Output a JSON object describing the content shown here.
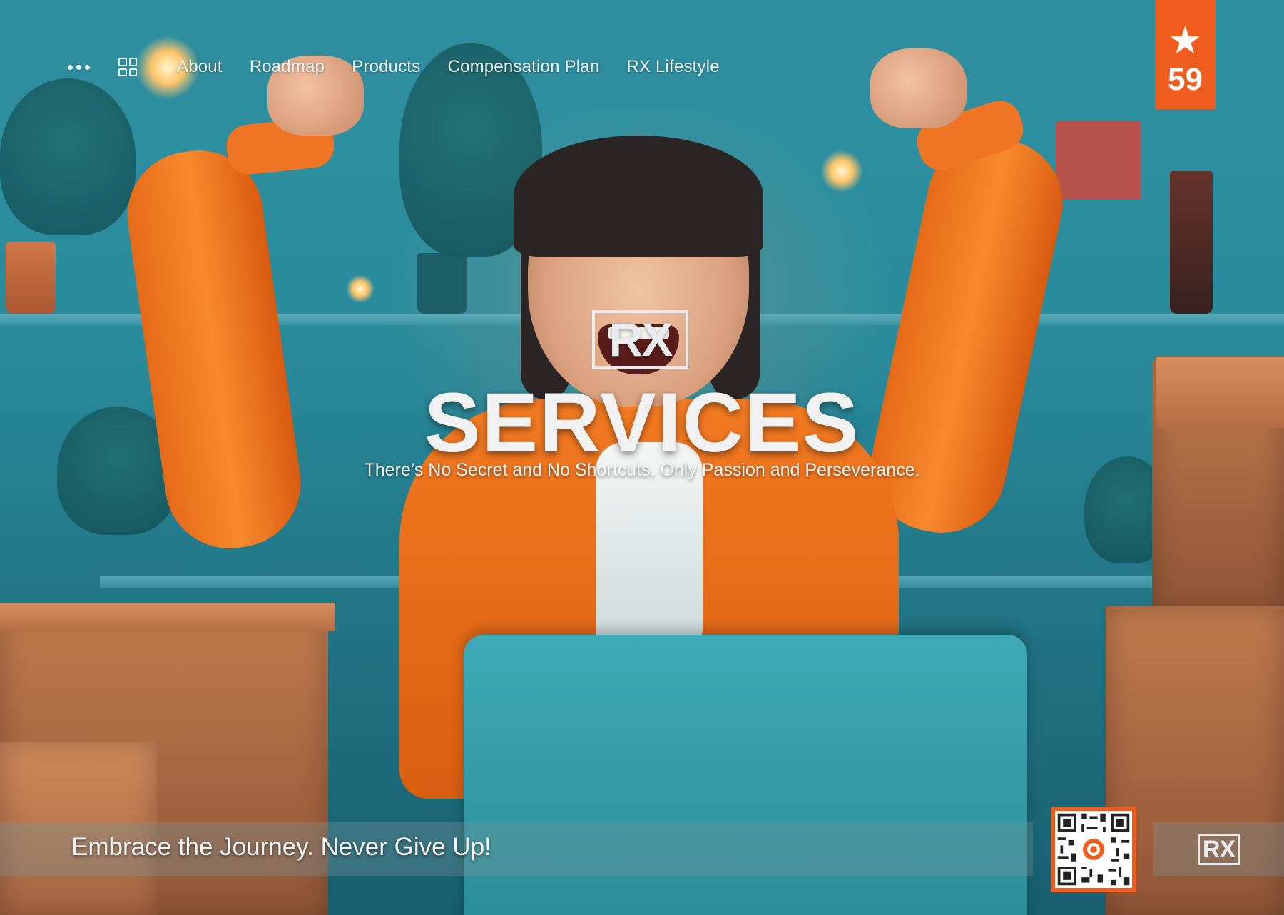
{
  "nav": {
    "items": [
      "About",
      "Roadmap",
      "Products",
      "Compensation Plan",
      "RX Lifestyle"
    ]
  },
  "badge": {
    "icon": "star-icon",
    "count": "59"
  },
  "hero": {
    "logo_text": "RX",
    "headline": "SERVICES",
    "tagline": "There’s No Secret and No Shortcuts, Only Passion and Perseverance."
  },
  "footer": {
    "slogan": "Embrace the Journey. Never Give Up!",
    "logo_text": "RX"
  },
  "colors": {
    "accent": "#ef5d1e",
    "background_teal": "#2a8c9d",
    "jacket_orange": "#f27a22"
  }
}
